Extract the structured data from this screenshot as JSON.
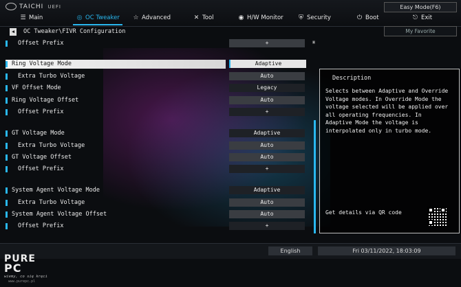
{
  "brand": {
    "name": "TAICHI",
    "suffix": "UEFI"
  },
  "easy_mode": "Easy Mode(F6)",
  "nav": [
    {
      "label": "Main",
      "icon": "menu-icon"
    },
    {
      "label": "OC Tweaker",
      "icon": "flame-icon"
    },
    {
      "label": "Advanced",
      "icon": "star-icon"
    },
    {
      "label": "Tool",
      "icon": "tools-icon"
    },
    {
      "label": "H/W Monitor",
      "icon": "monitor-icon"
    },
    {
      "label": "Security",
      "icon": "shield-icon"
    },
    {
      "label": "Boot",
      "icon": "power-icon"
    },
    {
      "label": "Exit",
      "icon": "exit-icon"
    }
  ],
  "breadcrumb": "OC Tweaker\\FIVR Configuration",
  "my_favorite": "My Favorite",
  "settings": [
    {
      "label": "Offset Prefix",
      "value": "+"
    },
    {
      "label": "Ring Voltage Mode",
      "value": "Adaptive"
    },
    {
      "label": "Extra Turbo Voltage",
      "value": "Auto"
    },
    {
      "label": "VF Offset Mode",
      "value": "Legacy"
    },
    {
      "label": "Ring Voltage Offset",
      "value": "Auto"
    },
    {
      "label": "Offset Prefix",
      "value": "+"
    },
    {
      "label": "GT Voltage Mode",
      "value": "Adaptive"
    },
    {
      "label": "Extra Turbo Voltage",
      "value": "Auto"
    },
    {
      "label": "GT Voltage Offset",
      "value": "Auto"
    },
    {
      "label": "Offset Prefix",
      "value": "+"
    },
    {
      "label": "System Agent Voltage Mode",
      "value": "Adaptive"
    },
    {
      "label": "Extra Turbo Voltage",
      "value": "Auto"
    },
    {
      "label": "System Agent Voltage Offset",
      "value": "Auto"
    },
    {
      "label": "Offset Prefix",
      "value": "+"
    }
  ],
  "description": {
    "title": "Description",
    "body": "Selects between Adaptive and Override\nVoltage modes. In Override Mode the\nvoltage selected will be applied over\nall operating frequencies. In\nAdaptive Mode the voltage is\ninterpolated only in turbo mode.",
    "qr_label": "Get details via QR code"
  },
  "footer": {
    "language": "English",
    "datetime": "Fri 03/11/2022, 18:03:09"
  },
  "watermark": {
    "logo_top": "PURE",
    "logo_bottom": "PC",
    "tagline": "wiemy, co się kręci",
    "url": "www.purepc.pl"
  },
  "colors": {
    "accent": "#29b8f0"
  }
}
